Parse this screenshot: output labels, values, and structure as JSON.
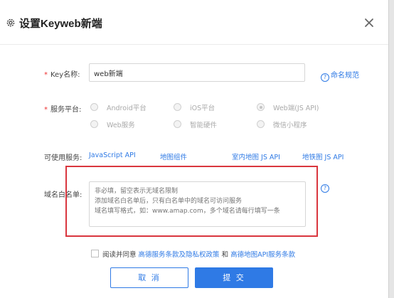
{
  "dialog": {
    "title": "设置Keyweb新端",
    "close_icon": "close-icon",
    "gear_icon": "gear-icon"
  },
  "form": {
    "key_name": {
      "required_mark": "*",
      "label": "Key名称:",
      "value": "web新端",
      "help_link": "命名规范"
    },
    "platform": {
      "required_mark": "*",
      "label": "服务平台:",
      "options": [
        "Android平台",
        "iOS平台",
        "Web端(JS API)",
        "Web服务",
        "智能硬件",
        "微信小程序"
      ],
      "selected": "Web端(JS API)"
    },
    "services": {
      "label": "可使用服务:",
      "items": [
        "JavaScript API",
        "地图组件",
        "室内地图 JS API",
        "地铁图 JS API"
      ]
    },
    "whitelist": {
      "label": "域名白名单:",
      "placeholder": "非必填，留空表示无域名限制\n添加域名白名单后，只有白名单中的域名可访问服务\n域名填写格式，如：www.amap.com，多个域名请每行填写一条",
      "help": "?"
    },
    "agreement": {
      "prefix": "阅读并同意",
      "link1": "高德服务条款及隐私权政策",
      "middle": "和",
      "link2": "高德地图API服务条款"
    }
  },
  "buttons": {
    "cancel": "取 消",
    "submit": "提 交"
  },
  "colors": {
    "accent": "#2f7ae5",
    "required": "#e33333",
    "highlight_box": "#d9363e"
  }
}
